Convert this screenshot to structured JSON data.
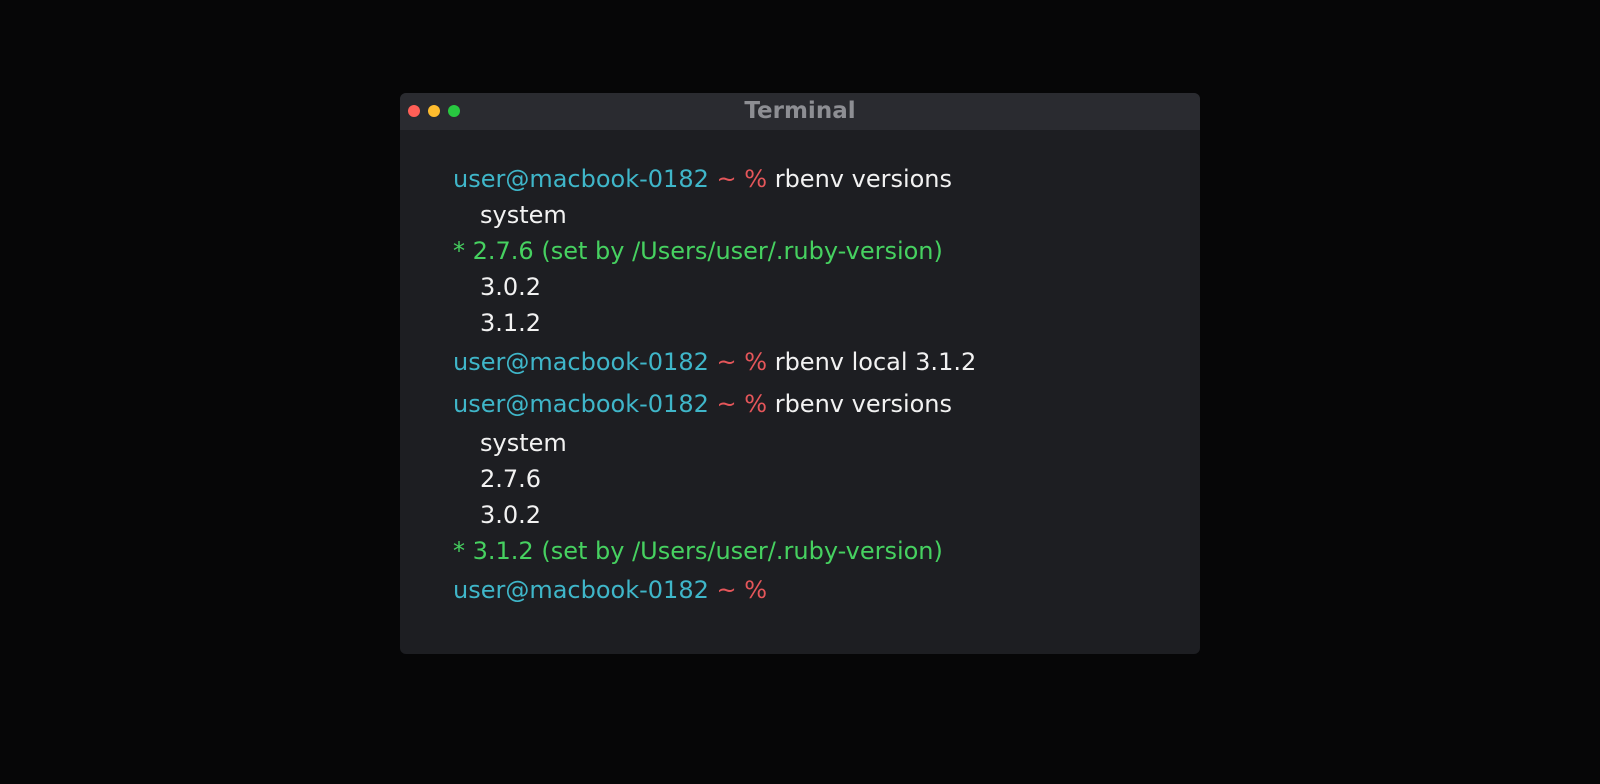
{
  "window": {
    "title": "Terminal",
    "traffic_lights": {
      "close_color": "#ff5f57",
      "minimize_color": "#febc2e",
      "maximize_color": "#28c840"
    }
  },
  "colors": {
    "prompt_user": "#3fb6c9",
    "prompt_sign": "#e5565a",
    "active_version": "#46d160",
    "output_text": "#f2f2f2"
  },
  "terminal": {
    "prompt_user": "user@macbook-0182",
    "prompt_sign": "~ %",
    "lines": [
      {
        "type": "prompt",
        "command": "rbenv versions"
      },
      {
        "type": "output",
        "text": "system"
      },
      {
        "type": "active",
        "text": "* 2.7.6 (set by /Users/user/.ruby-version)"
      },
      {
        "type": "output",
        "text": "3.0.2"
      },
      {
        "type": "output",
        "text": "3.1.2"
      },
      {
        "type": "prompt",
        "command": "rbenv local 3.1.2"
      },
      {
        "type": "prompt",
        "command": "rbenv versions"
      },
      {
        "type": "output",
        "text": "system"
      },
      {
        "type": "output",
        "text": "2.7.6"
      },
      {
        "type": "output",
        "text": "3.0.2"
      },
      {
        "type": "active",
        "text": "* 3.1.2 (set by /Users/user/.ruby-version)"
      },
      {
        "type": "prompt",
        "command": ""
      }
    ]
  }
}
